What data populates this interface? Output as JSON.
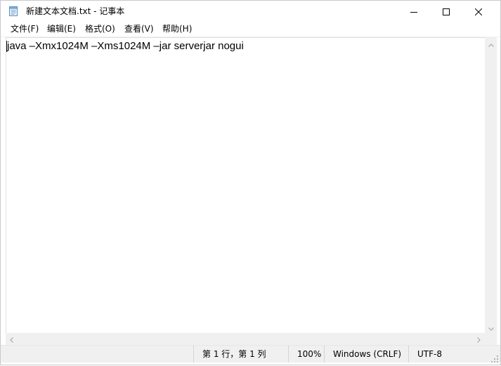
{
  "window": {
    "title": "新建文本文档.txt - 记事本",
    "icon": "notepad-icon"
  },
  "title_buttons": {
    "minimize_icon": "minimize-icon",
    "maximize_icon": "maximize-icon",
    "close_icon": "close-icon"
  },
  "menubar": {
    "items": [
      {
        "label": "文件(F)"
      },
      {
        "label": "编辑(E)"
      },
      {
        "label": "格式(O)"
      },
      {
        "label": "查看(V)"
      },
      {
        "label": "帮助(H)"
      }
    ]
  },
  "editor": {
    "content": "java –Xmx1024M –Xms1024M –jar serverjar nogui"
  },
  "statusbar": {
    "position": "第 1 行，第 1 列",
    "zoom": "100%",
    "line_ending": "Windows (CRLF)",
    "encoding": "UTF-8"
  },
  "colors": {
    "chrome_bg": "#f0f0f0",
    "editor_bg": "#ffffff",
    "text": "#000000"
  }
}
